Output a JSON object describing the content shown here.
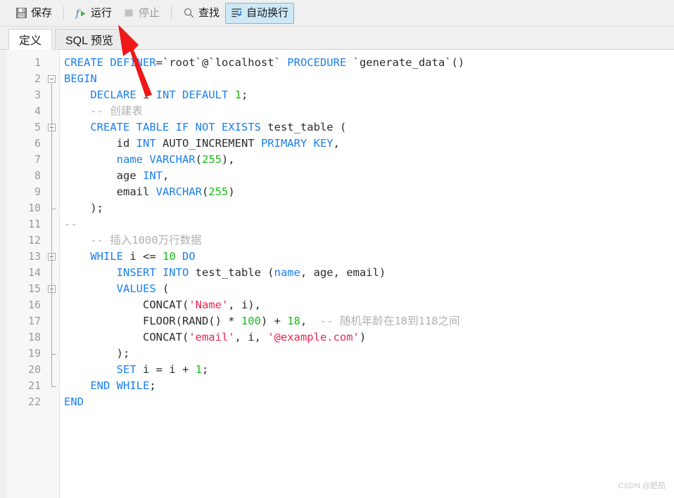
{
  "toolbar": {
    "buttons": [
      {
        "id": "save",
        "label": "保存",
        "icon": "floppy-disk-icon",
        "state": "normal"
      },
      {
        "id": "run",
        "label": "运行",
        "icon": "function-run-icon",
        "state": "normal"
      },
      {
        "id": "stop",
        "label": "停止",
        "icon": "stop-square-icon",
        "state": "disabled"
      },
      {
        "id": "find",
        "label": "查找",
        "icon": "search-icon",
        "state": "normal"
      },
      {
        "id": "wordwrap",
        "label": "自动换行",
        "icon": "word-wrap-icon",
        "state": "selected"
      }
    ]
  },
  "tabs": [
    {
      "id": "definition",
      "label": "定义",
      "active": true
    },
    {
      "id": "sqlpreview",
      "label": "SQL 预览",
      "active": false
    }
  ],
  "editor": {
    "language": "sql",
    "line_count": 22,
    "lines": [
      {
        "n": 1,
        "fold": "none",
        "tokens": [
          {
            "t": "kw",
            "v": "CREATE DEFINER"
          },
          {
            "t": "pln",
            "v": "=`root`@`localhost` "
          },
          {
            "t": "kw",
            "v": "PROCEDURE"
          },
          {
            "t": "pln",
            "v": " `generate_data`()"
          }
        ]
      },
      {
        "n": 2,
        "fold": "open",
        "tokens": [
          {
            "t": "kw",
            "v": "BEGIN"
          }
        ]
      },
      {
        "n": 3,
        "fold": "bar",
        "tokens": [
          {
            "t": "pln",
            "v": "    "
          },
          {
            "t": "kw",
            "v": "DECLARE"
          },
          {
            "t": "pln",
            "v": " i "
          },
          {
            "t": "kw",
            "v": "INT DEFAULT"
          },
          {
            "t": "pln",
            "v": " "
          },
          {
            "t": "num",
            "v": "1"
          },
          {
            "t": "pln",
            "v": ";"
          }
        ]
      },
      {
        "n": 4,
        "fold": "bar",
        "tokens": [
          {
            "t": "pln",
            "v": "    "
          },
          {
            "t": "cmt",
            "v": "-- 创建表"
          }
        ]
      },
      {
        "n": 5,
        "fold": "open",
        "tokens": [
          {
            "t": "pln",
            "v": "    "
          },
          {
            "t": "kw",
            "v": "CREATE TABLE IF NOT EXISTS"
          },
          {
            "t": "pln",
            "v": " test_table ("
          }
        ]
      },
      {
        "n": 6,
        "fold": "bar",
        "tokens": [
          {
            "t": "pln",
            "v": "        id "
          },
          {
            "t": "kw",
            "v": "INT"
          },
          {
            "t": "pln",
            "v": " AUTO_INCREMENT "
          },
          {
            "t": "kw",
            "v": "PRIMARY KEY"
          },
          {
            "t": "pln",
            "v": ","
          }
        ]
      },
      {
        "n": 7,
        "fold": "bar",
        "tokens": [
          {
            "t": "pln",
            "v": "        "
          },
          {
            "t": "kw",
            "v": "name VARCHAR"
          },
          {
            "t": "pln",
            "v": "("
          },
          {
            "t": "num",
            "v": "255"
          },
          {
            "t": "pln",
            "v": "),"
          }
        ]
      },
      {
        "n": 8,
        "fold": "bar",
        "tokens": [
          {
            "t": "pln",
            "v": "        age "
          },
          {
            "t": "kw",
            "v": "INT"
          },
          {
            "t": "pln",
            "v": ","
          }
        ]
      },
      {
        "n": 9,
        "fold": "bar",
        "tokens": [
          {
            "t": "pln",
            "v": "        email "
          },
          {
            "t": "kw",
            "v": "VARCHAR"
          },
          {
            "t": "pln",
            "v": "("
          },
          {
            "t": "num",
            "v": "255"
          },
          {
            "t": "pln",
            "v": ")"
          }
        ]
      },
      {
        "n": 10,
        "fold": "close",
        "tokens": [
          {
            "t": "pln",
            "v": "    );"
          }
        ]
      },
      {
        "n": 11,
        "fold": "bar",
        "tokens": [
          {
            "t": "cmt",
            "v": "--"
          }
        ]
      },
      {
        "n": 12,
        "fold": "bar",
        "tokens": [
          {
            "t": "pln",
            "v": "    "
          },
          {
            "t": "cmt",
            "v": "-- 插入1000万行数据"
          }
        ]
      },
      {
        "n": 13,
        "fold": "open",
        "tokens": [
          {
            "t": "pln",
            "v": "    "
          },
          {
            "t": "kw",
            "v": "WHILE"
          },
          {
            "t": "pln",
            "v": " i <= "
          },
          {
            "t": "num",
            "v": "10"
          },
          {
            "t": "pln",
            "v": " "
          },
          {
            "t": "kw",
            "v": "DO"
          }
        ]
      },
      {
        "n": 14,
        "fold": "bar",
        "tokens": [
          {
            "t": "pln",
            "v": "        "
          },
          {
            "t": "kw",
            "v": "INSERT INTO"
          },
          {
            "t": "pln",
            "v": " test_table ("
          },
          {
            "t": "kw",
            "v": "name"
          },
          {
            "t": "pln",
            "v": ", age, email)"
          }
        ]
      },
      {
        "n": 15,
        "fold": "open",
        "tokens": [
          {
            "t": "pln",
            "v": "        "
          },
          {
            "t": "kw",
            "v": "VALUES"
          },
          {
            "t": "pln",
            "v": " ("
          }
        ]
      },
      {
        "n": 16,
        "fold": "bar",
        "tokens": [
          {
            "t": "pln",
            "v": "            CONCAT("
          },
          {
            "t": "str",
            "v": "'Name'"
          },
          {
            "t": "pln",
            "v": ", i),"
          }
        ]
      },
      {
        "n": 17,
        "fold": "bar",
        "tokens": [
          {
            "t": "pln",
            "v": "            FLOOR(RAND() * "
          },
          {
            "t": "num",
            "v": "100"
          },
          {
            "t": "pln",
            "v": ") + "
          },
          {
            "t": "num",
            "v": "18"
          },
          {
            "t": "pln",
            "v": ",  "
          },
          {
            "t": "cmt",
            "v": "-- 随机年龄在18到118之间"
          }
        ]
      },
      {
        "n": 18,
        "fold": "bar",
        "tokens": [
          {
            "t": "pln",
            "v": "            CONCAT("
          },
          {
            "t": "str",
            "v": "'email'"
          },
          {
            "t": "pln",
            "v": ", i, "
          },
          {
            "t": "str",
            "v": "'@example.com'"
          },
          {
            "t": "pln",
            "v": ")"
          }
        ]
      },
      {
        "n": 19,
        "fold": "close",
        "tokens": [
          {
            "t": "pln",
            "v": "        );"
          }
        ]
      },
      {
        "n": 20,
        "fold": "bar",
        "tokens": [
          {
            "t": "pln",
            "v": "        "
          },
          {
            "t": "kw",
            "v": "SET"
          },
          {
            "t": "pln",
            "v": " i = i + "
          },
          {
            "t": "num",
            "v": "1"
          },
          {
            "t": "pln",
            "v": ";"
          }
        ]
      },
      {
        "n": 21,
        "fold": "close",
        "tokens": [
          {
            "t": "pln",
            "v": "    "
          },
          {
            "t": "kw",
            "v": "END WHILE"
          },
          {
            "t": "pln",
            "v": ";"
          }
        ]
      },
      {
        "n": 22,
        "fold": "none",
        "tokens": [
          {
            "t": "kw",
            "v": "END"
          }
        ]
      }
    ]
  },
  "annotation": {
    "type": "arrow",
    "color": "#f01818",
    "points_to": "run-button"
  },
  "watermark": {
    "text": "CSDN @肥茄"
  },
  "colors": {
    "keyword": "#1a7ff0",
    "number": "#17bd17",
    "string": "#e8254f",
    "comment": "#b0b0b0",
    "plain": "#2b2b2b",
    "toolbar_bg": "#f0f0f0",
    "selected_bg": "#cde8f6",
    "gutter_bg": "#f7f7f7",
    "accent": "#f01818"
  }
}
